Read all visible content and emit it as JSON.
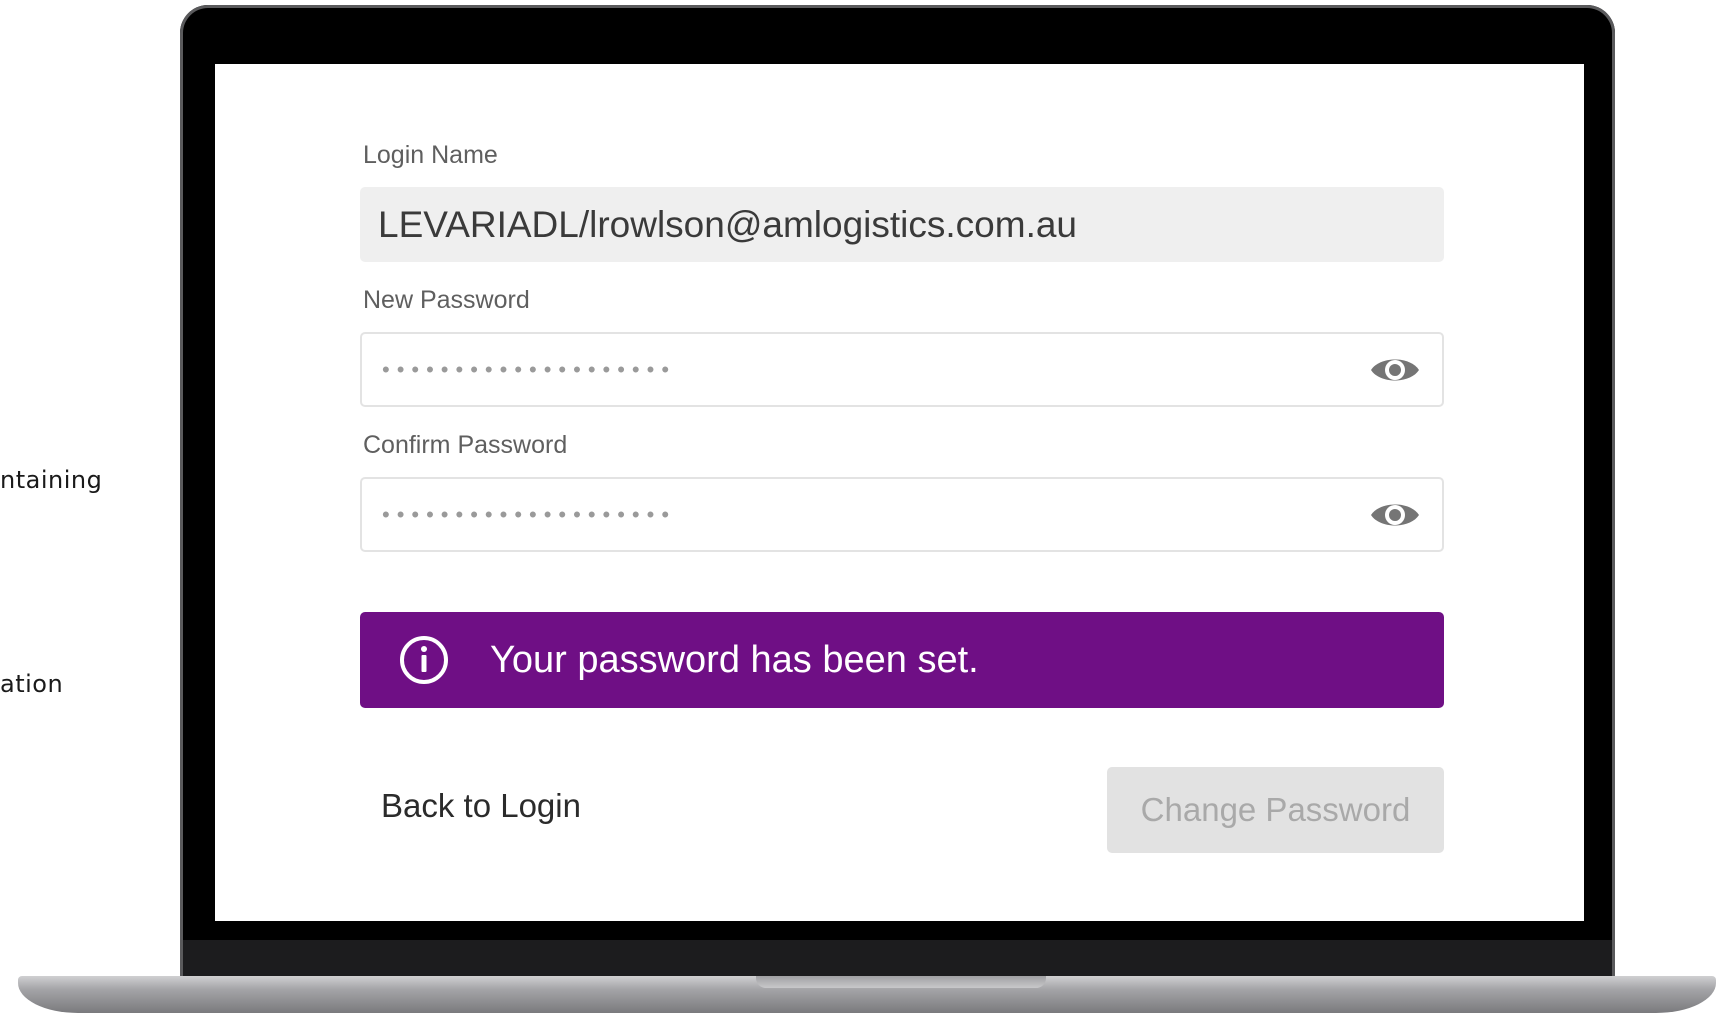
{
  "side_text": {
    "line1": "ntaining",
    "line2": "ation"
  },
  "form": {
    "login_name": {
      "label": "Login Name",
      "value": "LEVARIADL/lrowlson@amlogistics.com.au"
    },
    "new_password": {
      "label": "New Password",
      "masked_value": "••••••••••••••••••••",
      "icon": "eye-icon"
    },
    "confirm_password": {
      "label": "Confirm Password",
      "masked_value": "••••••••••••••••••••",
      "icon": "eye-icon"
    }
  },
  "notice": {
    "icon": "info-icon",
    "text": "Your password has been set.",
    "background_color": "#6f0f85"
  },
  "actions": {
    "back_label": "Back to Login",
    "change_label": "Change Password",
    "change_disabled": true
  }
}
